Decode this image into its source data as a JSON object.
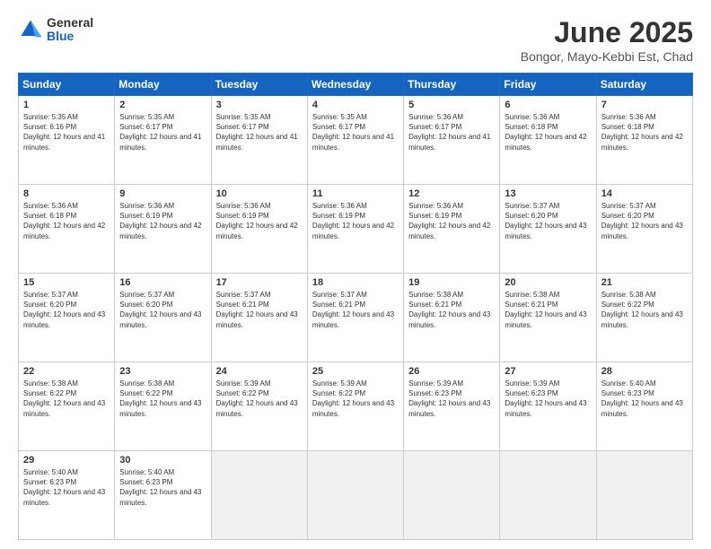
{
  "header": {
    "logo_general": "General",
    "logo_blue": "Blue",
    "month_title": "June 2025",
    "location": "Bongor, Mayo-Kebbi Est, Chad"
  },
  "weekdays": [
    "Sunday",
    "Monday",
    "Tuesday",
    "Wednesday",
    "Thursday",
    "Friday",
    "Saturday"
  ],
  "days": [
    {
      "num": "1",
      "sunrise": "5:35 AM",
      "sunset": "6:16 PM",
      "daylight": "12 hours and 41 minutes."
    },
    {
      "num": "2",
      "sunrise": "5:35 AM",
      "sunset": "6:17 PM",
      "daylight": "12 hours and 41 minutes."
    },
    {
      "num": "3",
      "sunrise": "5:35 AM",
      "sunset": "6:17 PM",
      "daylight": "12 hours and 41 minutes."
    },
    {
      "num": "4",
      "sunrise": "5:35 AM",
      "sunset": "6:17 PM",
      "daylight": "12 hours and 41 minutes."
    },
    {
      "num": "5",
      "sunrise": "5:36 AM",
      "sunset": "6:17 PM",
      "daylight": "12 hours and 41 minutes."
    },
    {
      "num": "6",
      "sunrise": "5:36 AM",
      "sunset": "6:18 PM",
      "daylight": "12 hours and 42 minutes."
    },
    {
      "num": "7",
      "sunrise": "5:36 AM",
      "sunset": "6:18 PM",
      "daylight": "12 hours and 42 minutes."
    },
    {
      "num": "8",
      "sunrise": "5:36 AM",
      "sunset": "6:18 PM",
      "daylight": "12 hours and 42 minutes."
    },
    {
      "num": "9",
      "sunrise": "5:36 AM",
      "sunset": "6:19 PM",
      "daylight": "12 hours and 42 minutes."
    },
    {
      "num": "10",
      "sunrise": "5:36 AM",
      "sunset": "6:19 PM",
      "daylight": "12 hours and 42 minutes."
    },
    {
      "num": "11",
      "sunrise": "5:36 AM",
      "sunset": "6:19 PM",
      "daylight": "12 hours and 42 minutes."
    },
    {
      "num": "12",
      "sunrise": "5:36 AM",
      "sunset": "6:19 PM",
      "daylight": "12 hours and 42 minutes."
    },
    {
      "num": "13",
      "sunrise": "5:37 AM",
      "sunset": "6:20 PM",
      "daylight": "12 hours and 43 minutes."
    },
    {
      "num": "14",
      "sunrise": "5:37 AM",
      "sunset": "6:20 PM",
      "daylight": "12 hours and 43 minutes."
    },
    {
      "num": "15",
      "sunrise": "5:37 AM",
      "sunset": "6:20 PM",
      "daylight": "12 hours and 43 minutes."
    },
    {
      "num": "16",
      "sunrise": "5:37 AM",
      "sunset": "6:20 PM",
      "daylight": "12 hours and 43 minutes."
    },
    {
      "num": "17",
      "sunrise": "5:37 AM",
      "sunset": "6:21 PM",
      "daylight": "12 hours and 43 minutes."
    },
    {
      "num": "18",
      "sunrise": "5:37 AM",
      "sunset": "6:21 PM",
      "daylight": "12 hours and 43 minutes."
    },
    {
      "num": "19",
      "sunrise": "5:38 AM",
      "sunset": "6:21 PM",
      "daylight": "12 hours and 43 minutes."
    },
    {
      "num": "20",
      "sunrise": "5:38 AM",
      "sunset": "6:21 PM",
      "daylight": "12 hours and 43 minutes."
    },
    {
      "num": "21",
      "sunrise": "5:38 AM",
      "sunset": "6:22 PM",
      "daylight": "12 hours and 43 minutes."
    },
    {
      "num": "22",
      "sunrise": "5:38 AM",
      "sunset": "6:22 PM",
      "daylight": "12 hours and 43 minutes."
    },
    {
      "num": "23",
      "sunrise": "5:38 AM",
      "sunset": "6:22 PM",
      "daylight": "12 hours and 43 minutes."
    },
    {
      "num": "24",
      "sunrise": "5:39 AM",
      "sunset": "6:22 PM",
      "daylight": "12 hours and 43 minutes."
    },
    {
      "num": "25",
      "sunrise": "5:39 AM",
      "sunset": "6:22 PM",
      "daylight": "12 hours and 43 minutes."
    },
    {
      "num": "26",
      "sunrise": "5:39 AM",
      "sunset": "6:23 PM",
      "daylight": "12 hours and 43 minutes."
    },
    {
      "num": "27",
      "sunrise": "5:39 AM",
      "sunset": "6:23 PM",
      "daylight": "12 hours and 43 minutes."
    },
    {
      "num": "28",
      "sunrise": "5:40 AM",
      "sunset": "6:23 PM",
      "daylight": "12 hours and 43 minutes."
    },
    {
      "num": "29",
      "sunrise": "5:40 AM",
      "sunset": "6:23 PM",
      "daylight": "12 hours and 43 minutes."
    },
    {
      "num": "30",
      "sunrise": "5:40 AM",
      "sunset": "6:23 PM",
      "daylight": "12 hours and 43 minutes."
    }
  ],
  "labels": {
    "sunrise": "Sunrise:",
    "sunset": "Sunset:",
    "daylight": "Daylight:"
  }
}
